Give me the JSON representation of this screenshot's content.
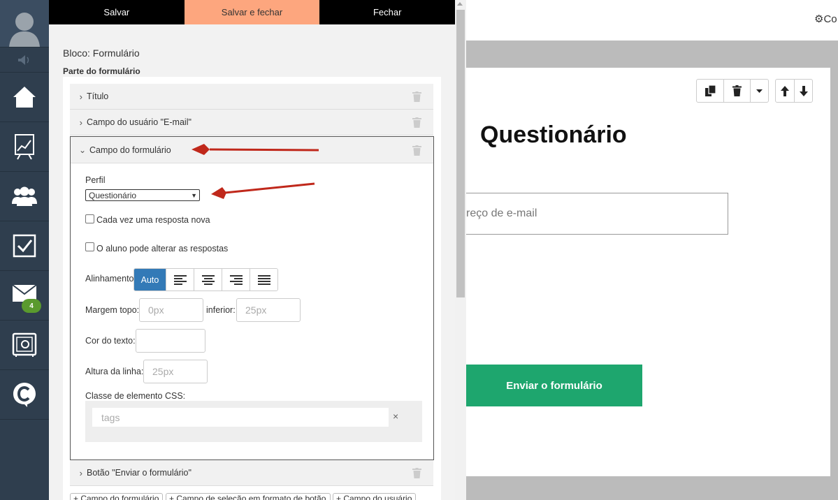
{
  "toolbar": {
    "save": "Salvar",
    "save_close": "Salvar e fechar",
    "close": "Fechar"
  },
  "editor": {
    "block_title": "Bloco: Formulário",
    "part_title": "Parte do formulário",
    "rows": {
      "title": "Título",
      "email_field": "Campo do usuário \"E-mail\"",
      "form_field": "Campo do formulário",
      "submit_button": "Botão \"Enviar o formulário\""
    },
    "form_field": {
      "profile_label": "Perfil",
      "profile_value": "Questionário",
      "new_answer_label": "Cada vez uma resposta nova",
      "can_change_label": "O aluno pode alterar as respostas",
      "alignment_label": "Alinhamento",
      "alignment_auto": "Auto",
      "margin_top_label": "Margem topo:",
      "margin_top_placeholder": "0px",
      "margin_bottom_label": "inferior:",
      "margin_bottom_placeholder": "25px",
      "text_color_label": "Cor do texto:",
      "line_height_label": "Altura da linha:",
      "line_height_placeholder": "25px",
      "css_class_label": "Classe de elemento CSS:",
      "tags_placeholder": "tags",
      "tags_clear": "×"
    },
    "add_buttons": [
      "+ Campo do formulário",
      "+ Campo de seleção em formato de botão",
      "+ Campo do usuário"
    ]
  },
  "nav": {
    "mail_badge": "4"
  },
  "preview": {
    "settings_text": "Co",
    "heading": "Questionário",
    "email_placeholder": "reço de e-mail",
    "submit": "Enviar o formulário"
  },
  "colors": {
    "nav_bg": "#2f3e4e",
    "save_close_bg": "#fda67e",
    "accent_blue": "#337ab7",
    "submit_green": "#1ea66e",
    "arrow_red": "#c0281b",
    "badge_green": "#5a9a2e"
  }
}
